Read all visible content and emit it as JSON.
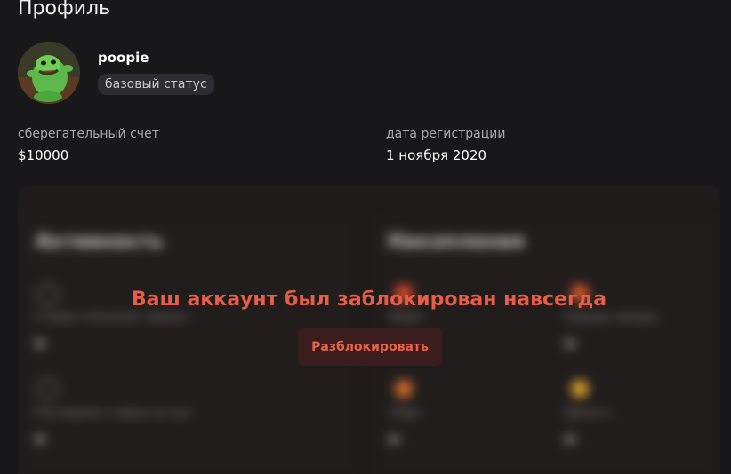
{
  "page": {
    "title": "Профиль"
  },
  "profile": {
    "username": "poopie",
    "status_badge": "базовый статус",
    "avatar": "slimer-ghost-avatar"
  },
  "stats": {
    "savings": {
      "label": "сберегательный счет",
      "value": "$10000"
    },
    "registration": {
      "label": "дата регистрации",
      "value": "1 ноября 2020"
    }
  },
  "lock": {
    "message": "Ваш аккаунт был заблокирован навсегда",
    "unlock_label": "Разблокировать",
    "accent_color": "#e85d45"
  },
  "blurred": {
    "left_heading": "Активность",
    "right_heading": "Накопления",
    "left_item_1": "Ставки пополнен заказы",
    "left_item_2": "Последние ставки на пул",
    "right_item_1": "Фарм",
    "right_item_2": "Курьер пакеры",
    "right_item_3": "Сбер",
    "right_item_4": "Деньги"
  },
  "colors": {
    "background": "#18181b",
    "badge_bg": "#2c2c31",
    "button_bg": "#3a1d1c",
    "button_text": "#e8644a"
  }
}
